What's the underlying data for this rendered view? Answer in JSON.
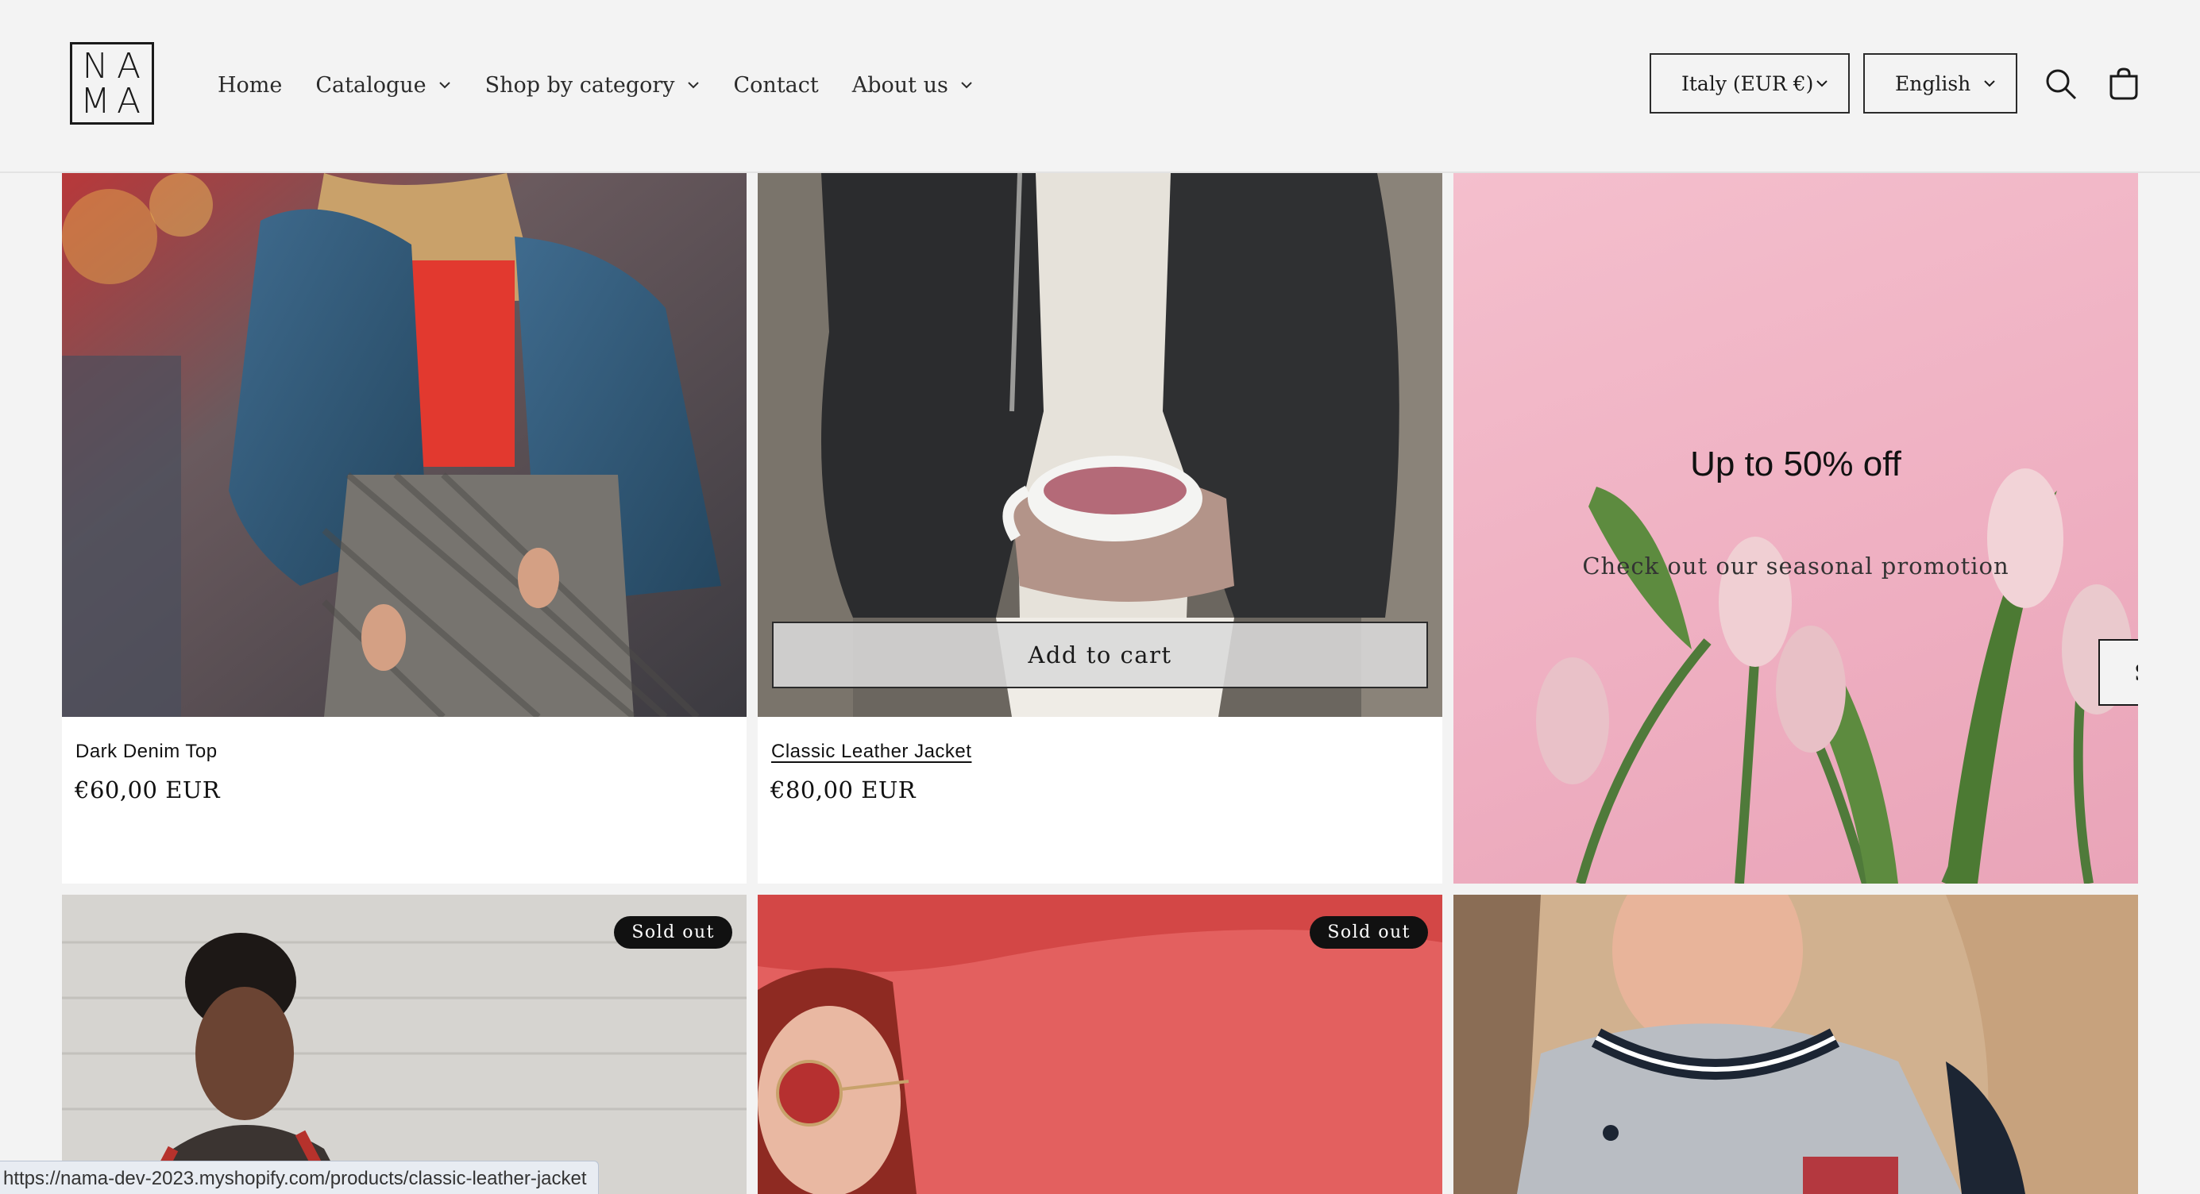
{
  "brand": {
    "logo_letters": [
      "N",
      "A",
      "M",
      "A"
    ]
  },
  "nav": [
    {
      "label": "Home",
      "has_dropdown": false
    },
    {
      "label": "Catalogue",
      "has_dropdown": true
    },
    {
      "label": "Shop by category",
      "has_dropdown": true
    },
    {
      "label": "Contact",
      "has_dropdown": false
    },
    {
      "label": "About us",
      "has_dropdown": true
    }
  ],
  "header": {
    "country_selector": "Italy (EUR €)",
    "language_selector": "English",
    "icons": [
      "search-icon",
      "cart-icon",
      "chevron-down-icon"
    ]
  },
  "products": [
    {
      "title": "Dark Denim Top",
      "price": "€60,00 EUR"
    },
    {
      "title": "Classic Leather Jacket",
      "price": "€80,00 EUR",
      "hover_action": "Add to cart"
    }
  ],
  "promo": {
    "title": "Up to 50% off",
    "subtitle": "Check out our seasonal promotion",
    "button": "Shop now"
  },
  "row2": {
    "badges": [
      "Sold out",
      "Sold out"
    ]
  },
  "status_bar": {
    "url": "https://nama-dev-2023.myshopify.com/products/classic-leather-jacket"
  },
  "colors": {
    "background": "#f3f3f3",
    "text": "#1a1a1a",
    "badge": "#111111",
    "promo_bg": "#efb0c2"
  }
}
